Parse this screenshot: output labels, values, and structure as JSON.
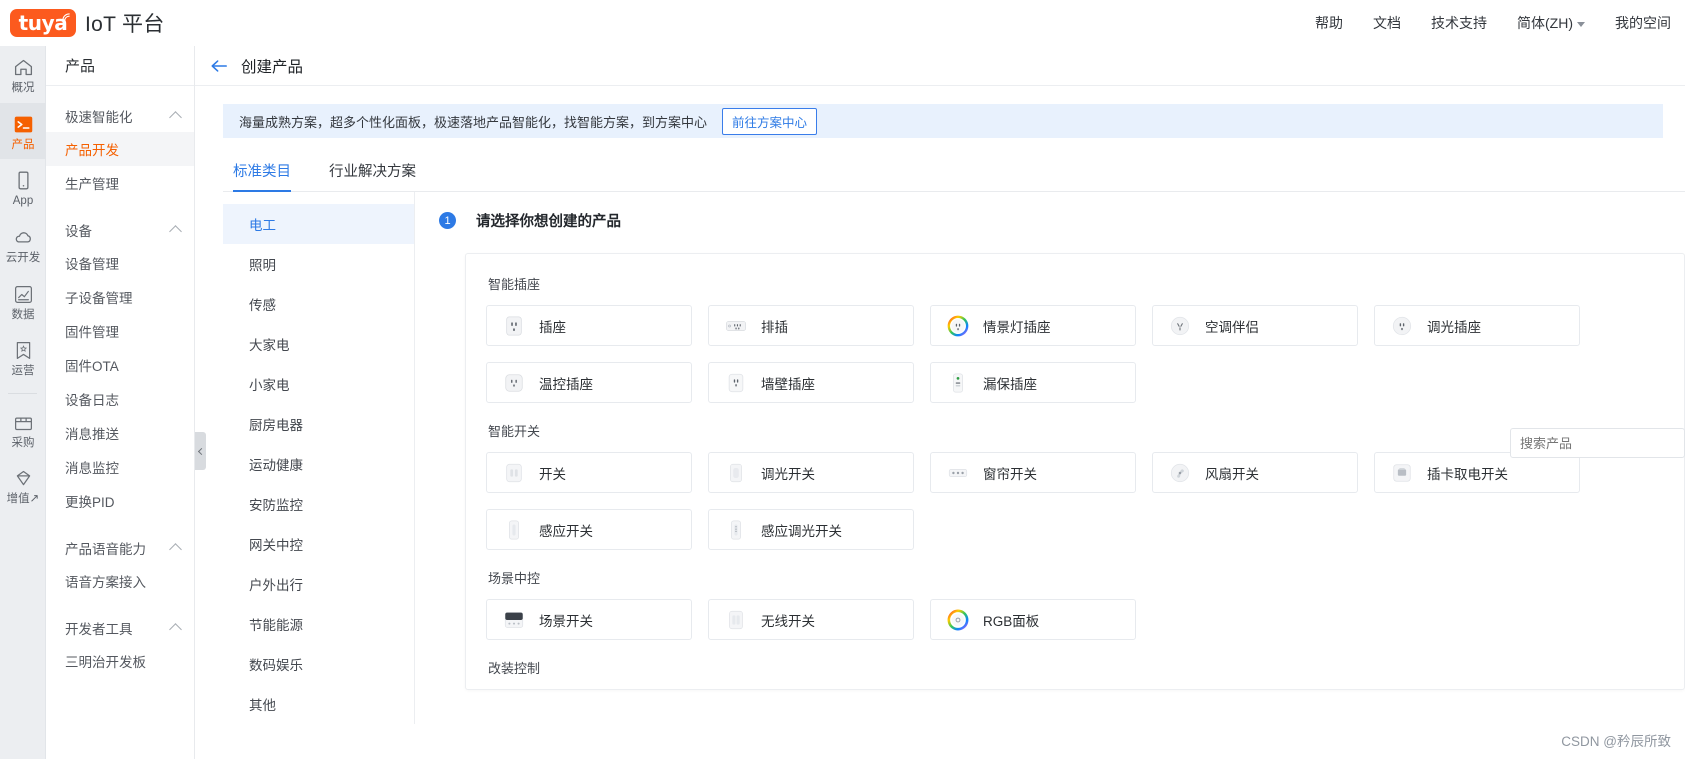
{
  "topbar": {
    "logo_text": "tuya",
    "brand_title": "IoT 平台",
    "nav": [
      {
        "label": "帮助"
      },
      {
        "label": "文档"
      },
      {
        "label": "技术支持"
      },
      {
        "label": "简体(ZH)",
        "has_caret": true
      },
      {
        "label": "我的空间"
      }
    ]
  },
  "rail": {
    "items": [
      {
        "label": "概况",
        "icon": "home-icon",
        "active": false
      },
      {
        "label": "产品",
        "icon": "terminal-icon",
        "active": true
      },
      {
        "label": "App",
        "icon": "phone-icon",
        "active": false
      },
      {
        "label": "云开发",
        "icon": "cloud-icon",
        "active": false
      },
      {
        "label": "数据",
        "icon": "chart-icon",
        "active": false
      },
      {
        "label": "运营",
        "icon": "bookmark-icon",
        "active": false
      },
      {
        "label": "采购",
        "icon": "box-icon",
        "active": false
      },
      {
        "label": "增值↗",
        "icon": "gem-icon",
        "active": false
      }
    ]
  },
  "subnav": {
    "header": "产品",
    "groups": [
      {
        "title": "极速智能化",
        "items": [
          {
            "label": "产品开发",
            "active": true
          },
          {
            "label": "生产管理",
            "active": false
          }
        ]
      },
      {
        "title": "设备",
        "items": [
          {
            "label": "设备管理",
            "active": false
          },
          {
            "label": "子设备管理",
            "active": false
          },
          {
            "label": "固件管理",
            "active": false
          },
          {
            "label": "固件OTA",
            "active": false
          },
          {
            "label": "设备日志",
            "active": false
          },
          {
            "label": "消息推送",
            "active": false
          },
          {
            "label": "消息监控",
            "active": false
          },
          {
            "label": "更换PID",
            "active": false
          }
        ]
      },
      {
        "title": "产品语音能力",
        "items": [
          {
            "label": "语音方案接入",
            "active": false
          }
        ]
      },
      {
        "title": "开发者工具",
        "items": [
          {
            "label": "三明治开发板",
            "active": false
          }
        ]
      }
    ]
  },
  "page": {
    "title": "创建产品",
    "banner": {
      "text": "海量成熟方案，超多个性化面板，极速落地产品智能化，找智能方案，到方案中心",
      "button": "前往方案中心"
    },
    "tabs": [
      {
        "label": "标准类目",
        "active": true
      },
      {
        "label": "行业解决方案",
        "active": false
      }
    ],
    "search": {
      "placeholder": "搜索产品"
    }
  },
  "categories": [
    {
      "label": "电工",
      "active": true
    },
    {
      "label": "照明",
      "active": false
    },
    {
      "label": "传感",
      "active": false
    },
    {
      "label": "大家电",
      "active": false
    },
    {
      "label": "小家电",
      "active": false
    },
    {
      "label": "厨房电器",
      "active": false
    },
    {
      "label": "运动健康",
      "active": false
    },
    {
      "label": "安防监控",
      "active": false
    },
    {
      "label": "网关中控",
      "active": false
    },
    {
      "label": "户外出行",
      "active": false
    },
    {
      "label": "节能能源",
      "active": false
    },
    {
      "label": "数码娱乐",
      "active": false
    },
    {
      "label": "其他",
      "active": false
    }
  ],
  "step": {
    "number": "1",
    "label": "请选择你想创建的产品"
  },
  "sections": [
    {
      "title": "智能插座",
      "rows": [
        [
          {
            "label": "插座",
            "icon": "outlet-icon"
          },
          {
            "label": "排插",
            "icon": "power-strip-icon"
          },
          {
            "label": "情景灯插座",
            "icon": "rgb-ring-outlet-icon"
          },
          {
            "label": "空调伴侣",
            "icon": "ac-companion-icon"
          },
          {
            "label": "调光插座",
            "icon": "dimmer-outlet-icon"
          }
        ],
        [
          {
            "label": "温控插座",
            "icon": "thermostat-outlet-icon"
          },
          {
            "label": "墙壁插座",
            "icon": "wall-outlet-icon"
          },
          {
            "label": "漏保插座",
            "icon": "leakage-outlet-icon"
          }
        ]
      ]
    },
    {
      "title": "智能开关",
      "rows": [
        [
          {
            "label": "开关",
            "icon": "switch-icon"
          },
          {
            "label": "调光开关",
            "icon": "dimmer-switch-icon"
          },
          {
            "label": "窗帘开关",
            "icon": "curtain-switch-icon"
          },
          {
            "label": "风扇开关",
            "icon": "fan-switch-icon"
          },
          {
            "label": "插卡取电开关",
            "icon": "card-switch-icon"
          }
        ],
        [
          {
            "label": "感应开关",
            "icon": "sensor-switch-icon"
          },
          {
            "label": "感应调光开关",
            "icon": "sensor-dimmer-icon"
          }
        ]
      ]
    },
    {
      "title": "场景中控",
      "rows": [
        [
          {
            "label": "场景开关",
            "icon": "scene-switch-icon"
          },
          {
            "label": "无线开关",
            "icon": "wireless-switch-icon"
          },
          {
            "label": "RGB面板",
            "icon": "rgb-panel-icon"
          }
        ]
      ]
    },
    {
      "title": "改装控制",
      "rows": []
    }
  ],
  "watermark": "CSDN @矜辰所致",
  "colors": {
    "brand_orange": "#fc5a1e",
    "accent_blue": "#2d7ae5",
    "banner_bg": "#e8f1fd",
    "rail_bg": "#eceef1"
  }
}
